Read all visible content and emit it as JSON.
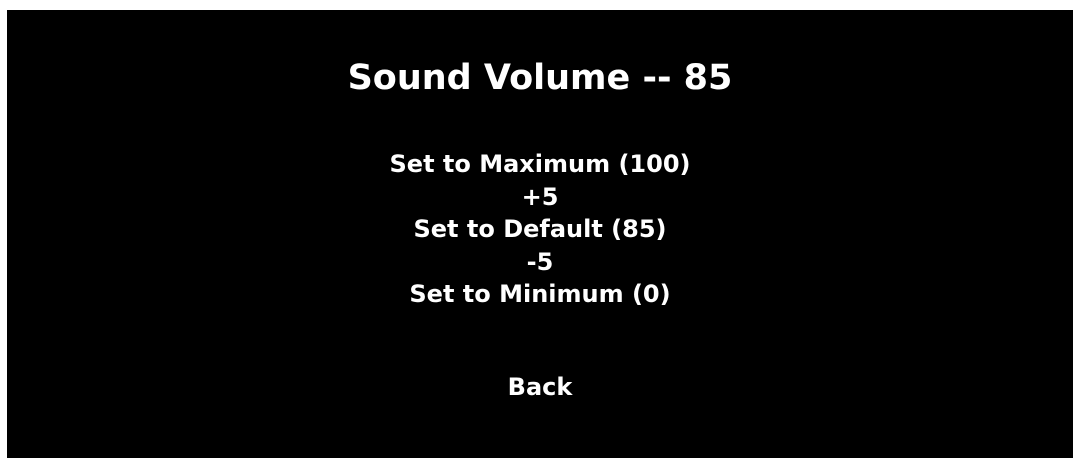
{
  "title": "Sound Volume -- 85",
  "menu": {
    "items": [
      {
        "label": "Set to Maximum (100)"
      },
      {
        "label": "+5"
      },
      {
        "label": "Set to Default (85)"
      },
      {
        "label": "-5"
      },
      {
        "label": "Set to Minimum (0)"
      }
    ],
    "back_label": "Back"
  },
  "colors": {
    "background": "#000000",
    "text": "#ffffff",
    "border": "#ffffff"
  }
}
